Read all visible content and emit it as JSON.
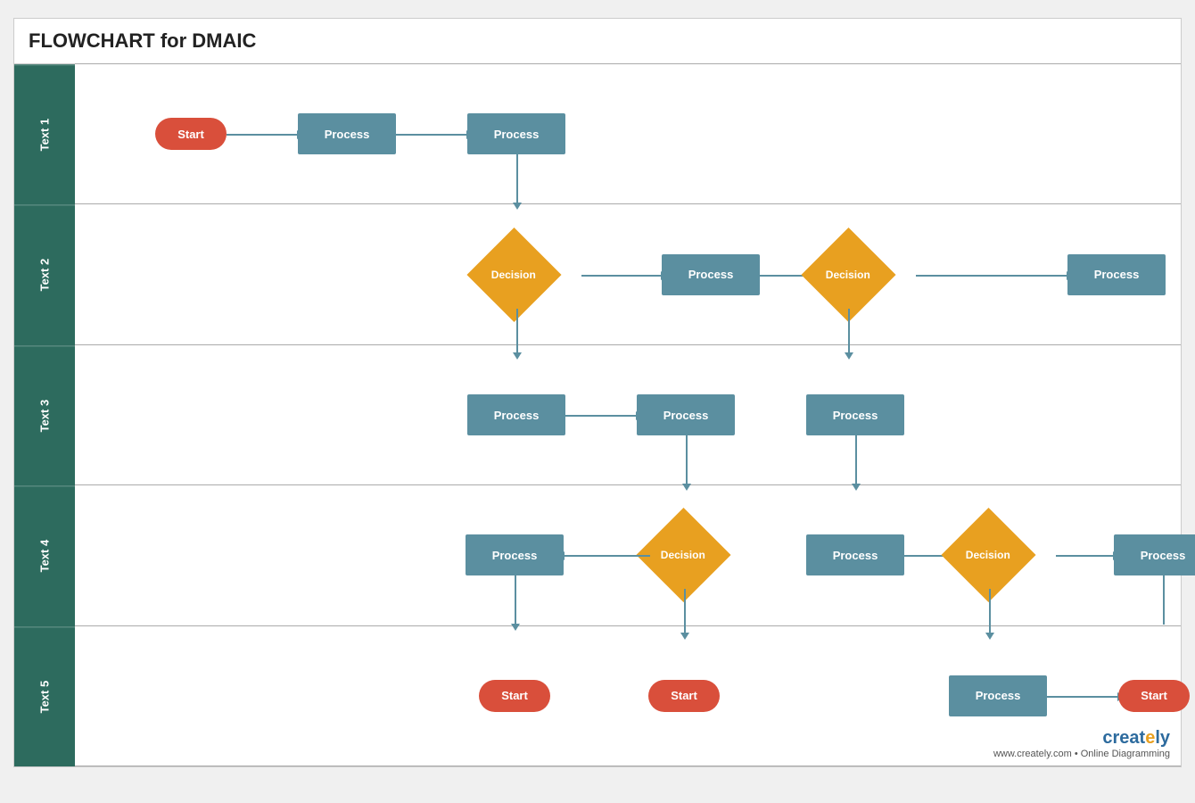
{
  "title": "FLOWCHART for DMAIC",
  "swimlanes": [
    {
      "label": "Text 1"
    },
    {
      "label": "Text 2"
    },
    {
      "label": "Text 3"
    },
    {
      "label": "Text 4"
    },
    {
      "label": "Text 5"
    }
  ],
  "shapes": {
    "start1": {
      "type": "oval",
      "label": "Start"
    },
    "process1": {
      "type": "rect",
      "label": "Process"
    },
    "process2": {
      "type": "rect",
      "label": "Process"
    },
    "decision1": {
      "type": "diamond",
      "label": "Decision"
    },
    "process3": {
      "type": "rect",
      "label": "Process"
    },
    "decision2": {
      "type": "diamond",
      "label": "Decision"
    },
    "process4": {
      "type": "rect",
      "label": "Process"
    },
    "process5": {
      "type": "rect",
      "label": "Process"
    },
    "process6": {
      "type": "rect",
      "label": "Process"
    },
    "process7": {
      "type": "rect",
      "label": "Process"
    },
    "decision3": {
      "type": "diamond",
      "label": "Decision"
    },
    "process8": {
      "type": "rect",
      "label": "Process"
    },
    "process9": {
      "type": "rect",
      "label": "Process"
    },
    "decision4": {
      "type": "diamond",
      "label": "Decision"
    },
    "process10": {
      "type": "rect",
      "label": "Process"
    },
    "start2": {
      "type": "oval",
      "label": "Start"
    },
    "start3": {
      "type": "oval",
      "label": "Start"
    },
    "process11": {
      "type": "rect",
      "label": "Process"
    },
    "start4": {
      "type": "oval",
      "label": "Start"
    }
  },
  "colors": {
    "rect_fill": "#5b8fa0",
    "oval_fill": "#d94f3b",
    "diamond_fill": "#e8a020",
    "swimlane_bg": "#2d6b5e",
    "arrow": "#5b8fa0"
  },
  "badge": {
    "brand": "creately",
    "url": "www.creately.com",
    "tagline": "Online Diagramming"
  }
}
